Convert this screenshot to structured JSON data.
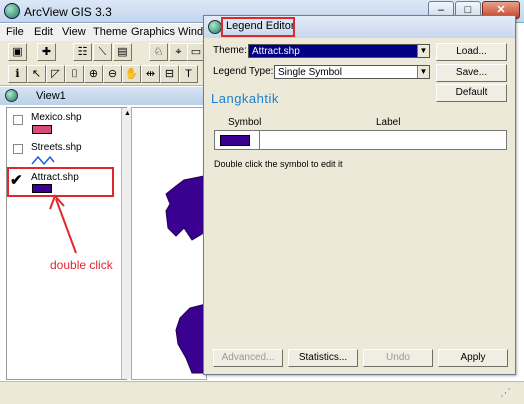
{
  "window": {
    "title": "ArcView GIS 3.3",
    "minimize": "–",
    "maximize": "□",
    "close": "✕"
  },
  "menubar": [
    "File",
    "Edit",
    "View",
    "Theme",
    "Graphics",
    "Windo"
  ],
  "toolbar": {
    "row1": [
      "floppy-disk-icon",
      "add-theme-icon",
      "theme-props-icon",
      "edit-legend-icon",
      "open-table-icon",
      "find-icon",
      "query-icon",
      "locate-icon"
    ],
    "row2": [
      "identify-icon",
      "pointer-icon",
      "vertex-icon",
      "zoom-in-icon",
      "zoom-out-icon",
      "pan-icon",
      "measure-icon",
      "label-icon",
      "text-icon"
    ]
  },
  "view": {
    "title": "View1",
    "themes": [
      {
        "name": "Mexico.shp",
        "checked": false,
        "symbol": "pink-fill"
      },
      {
        "name": "Streets.shp",
        "checked": false,
        "symbol": "blue-line"
      },
      {
        "name": "Attract.shp",
        "checked": true,
        "symbol": "purple-fill"
      }
    ]
  },
  "annotation": {
    "text": "double click"
  },
  "legend_editor": {
    "title": "Legend Editor",
    "theme_label": "Theme:",
    "theme_value": "Attract.shp",
    "legend_type_label": "Legend Type:",
    "legend_type_value": "Single Symbol",
    "watermark": "Langkahtik",
    "buttons": {
      "load": "Load...",
      "save": "Save...",
      "default": "Default"
    },
    "table": {
      "col_symbol": "Symbol",
      "col_label": "Label"
    },
    "hint": "Double click the symbol to edit it",
    "bottom_buttons": {
      "advanced": "Advanced...",
      "statistics": "Statistics...",
      "undo": "Undo",
      "apply": "Apply"
    }
  },
  "colors": {
    "accent_red": "#e0282c",
    "theme_purple": "#3a0090",
    "mexico_pink": "#d84a7e",
    "streets_blue": "#1e5fd8"
  }
}
